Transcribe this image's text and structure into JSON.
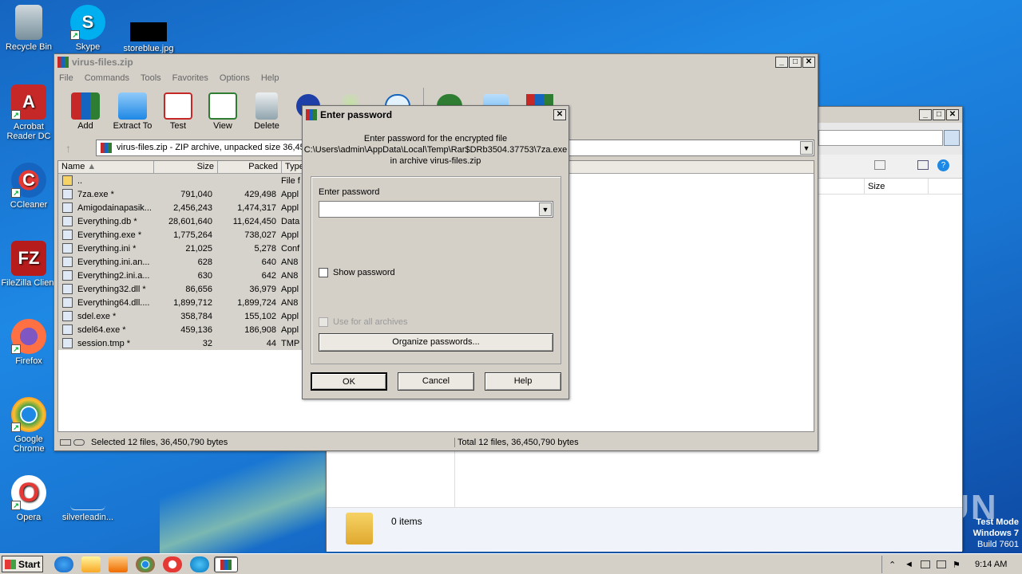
{
  "desktop": {
    "icons": [
      {
        "label": "Recycle Bin",
        "icon": "recycle-bin-icon"
      },
      {
        "label": "Skype",
        "icon": "skype-icon"
      },
      {
        "label": "storeblue.jpg",
        "icon": "image-file-icon"
      },
      {
        "label": "Acrobat Reader DC",
        "icon": "acrobat-icon"
      },
      {
        "label": "CCleaner",
        "icon": "ccleaner-icon"
      },
      {
        "label": "FileZilla Client",
        "icon": "filezilla-icon"
      },
      {
        "label": "Firefox",
        "icon": "firefox-icon"
      },
      {
        "label": "Google Chrome",
        "icon": "chrome-icon"
      },
      {
        "label": "Opera",
        "icon": "opera-icon"
      },
      {
        "label": "silverleadin...",
        "icon": "file-icon"
      }
    ],
    "watermark": "ANY RUN",
    "test_mode": [
      "Test Mode",
      "Windows 7",
      "Build 7601"
    ]
  },
  "winrar": {
    "title": "virus-files.zip",
    "menu": [
      "File",
      "Commands",
      "Tools",
      "Favorites",
      "Options",
      "Help"
    ],
    "toolbar": [
      "Add",
      "Extract To",
      "Test",
      "View",
      "Delete"
    ],
    "path": "virus-files.zip - ZIP archive, unpacked size 36,45",
    "columns": [
      "Name",
      "Size",
      "Packed",
      "Type"
    ],
    "files": [
      {
        "name": "..",
        "size": "",
        "packed": "",
        "type": "File f"
      },
      {
        "name": "7za.exe *",
        "size": "791,040",
        "packed": "429,498",
        "type": "Appl"
      },
      {
        "name": "Amigodainapasik....",
        "size": "2,456,243",
        "packed": "1,474,317",
        "type": "Appl"
      },
      {
        "name": "Everything.db *",
        "size": "28,601,640",
        "packed": "11,624,450",
        "type": "Data"
      },
      {
        "name": "Everything.exe *",
        "size": "1,775,264",
        "packed": "738,027",
        "type": "Appl"
      },
      {
        "name": "Everything.ini *",
        "size": "21,025",
        "packed": "5,278",
        "type": "Conf"
      },
      {
        "name": "Everything.ini.an...",
        "size": "628",
        "packed": "640",
        "type": "AN8"
      },
      {
        "name": "Everything2.ini.a...",
        "size": "630",
        "packed": "642",
        "type": "AN8"
      },
      {
        "name": "Everything32.dll *",
        "size": "86,656",
        "packed": "36,979",
        "type": "Appl"
      },
      {
        "name": "Everything64.dll....",
        "size": "1,899,712",
        "packed": "1,899,724",
        "type": "AN8"
      },
      {
        "name": "sdel.exe *",
        "size": "358,784",
        "packed": "155,102",
        "type": "Appl"
      },
      {
        "name": "sdel64.exe *",
        "size": "459,136",
        "packed": "186,908",
        "type": "Appl"
      },
      {
        "name": "session.tmp *",
        "size": "32",
        "packed": "44",
        "type": "TMP"
      }
    ],
    "status_left": "Selected 12 files, 36,450,790 bytes",
    "status_right": "Total 12 files, 36,450,790 bytes"
  },
  "explorer": {
    "column_size": "Size",
    "items_count": "0 items"
  },
  "dialog": {
    "title": "Enter password",
    "line1": "Enter password for the encrypted file",
    "line2": "C:\\Users\\admin\\AppData\\Local\\Temp\\Rar$DRb3504.37753\\7za.exe",
    "line3": "in archive virus-files.zip",
    "password_label": "Enter password",
    "password_value": "",
    "show_password": "Show password",
    "use_all": "Use for all archives",
    "organize": "Organize passwords...",
    "ok": "OK",
    "cancel": "Cancel",
    "help": "Help"
  },
  "taskbar": {
    "start": "Start",
    "clock": "9:14 AM"
  }
}
